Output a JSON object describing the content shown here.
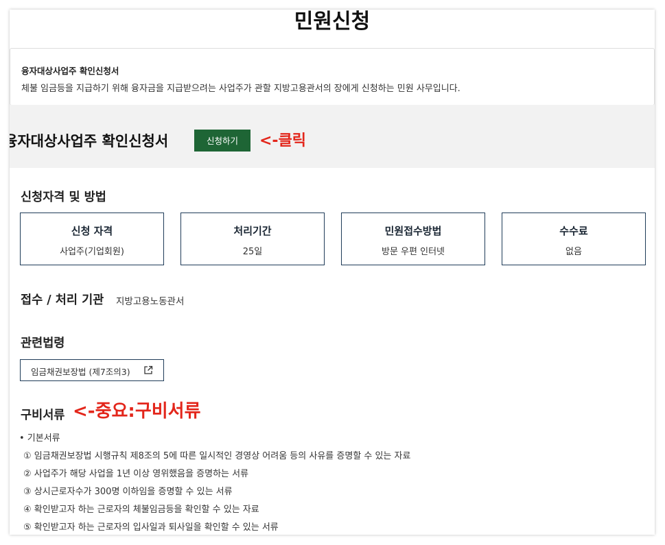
{
  "page": {
    "title": "민원신청"
  },
  "intro": {
    "title": "융자대상사업주 확인신청서",
    "description": "체불 임금등을 지급하기 위해 융자금을 지급받으려는 사업주가 관할 지방고용관서의 장에게 신청하는 민원 사무입니다."
  },
  "apply_section": {
    "form_name": "융자대상사업주 확인신청서",
    "apply_button": "신청하기",
    "annotation": "<-클릭"
  },
  "qualification": {
    "heading": "신청자격 및 방법",
    "cards": [
      {
        "title": "신청 자격",
        "value": "사업주(기업회원)"
      },
      {
        "title": "처리기간",
        "value": "25일"
      },
      {
        "title": "민원접수방법",
        "value": "방문 우편 인터넷"
      },
      {
        "title": "수수료",
        "value": "없음"
      }
    ]
  },
  "agency": {
    "heading": "접수 / 처리 기관",
    "value": "지방고용노동관서"
  },
  "law": {
    "heading": "관련법령",
    "link_text": "임금채권보장법 (제7조의3)",
    "icon": "external-link-icon"
  },
  "documents": {
    "heading": "구비서류",
    "annotation": "<-중요:구비서류",
    "group_label": "• 기본서류",
    "items": [
      "① 임금채권보장법 시행규칙 제8조의 5에 따른 일시적인 경영상 어려움 등의 사유를 증명할 수 있는 자료",
      "② 사업주가 해당 사업을 1년 이상 영위했음을 증명하는 서류",
      "③ 상시근로자수가 300명 이하임을 증명할 수 있는 서류",
      "④ 확인받고자 하는 근로자의 체불임금등을 확인할 수 있는 자료",
      "⑤ 확인받고자 하는 근로자의 입사일과 퇴사일을 확인할 수 있는 서류"
    ]
  },
  "colors": {
    "primary_green": "#1e6535",
    "card_border": "#1d3a57",
    "annotation_red": "#e3261b",
    "band_gray": "#f2f2f2"
  }
}
